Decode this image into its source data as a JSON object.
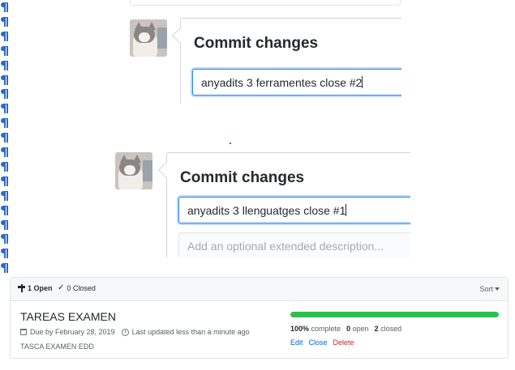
{
  "commit_panels": [
    {
      "title": "Commit changes",
      "message": "anyadits 3 ferramentes close #2",
      "description_placeholder": ""
    },
    {
      "title": "Commit changes",
      "message": "anyadits 3 llenguatges close #1",
      "description_placeholder": "Add an optional extended description..."
    }
  ],
  "milestones": {
    "tabs": {
      "open": "1 Open",
      "closed": "0 Closed"
    },
    "sort_label": "Sort",
    "items": [
      {
        "title": "TAREAS EXAMEN",
        "due": "Due by February 28, 2019",
        "updated": "Last updated less than a minute ago",
        "description": "TASCA EXAMEN EDD",
        "progress_percent": 100,
        "complete_pct": "100%",
        "complete_label": "complete",
        "open_count": "0",
        "open_label": "open",
        "closed_count": "2",
        "closed_label": "closed",
        "actions": {
          "edit": "Edit",
          "close": "Close",
          "delete": "Delete"
        }
      }
    ]
  },
  "colors": {
    "progress": "#2cbe4e",
    "link": "#0366d6",
    "danger": "#cb2431",
    "focus": "#2188ff",
    "pilcrow": "#2b6ac8"
  },
  "icons": {
    "pilcrow": "pilcrow-icon",
    "milestone": "milestone-icon",
    "check": "check-icon",
    "calendar": "calendar-icon",
    "clock": "clock-icon"
  }
}
